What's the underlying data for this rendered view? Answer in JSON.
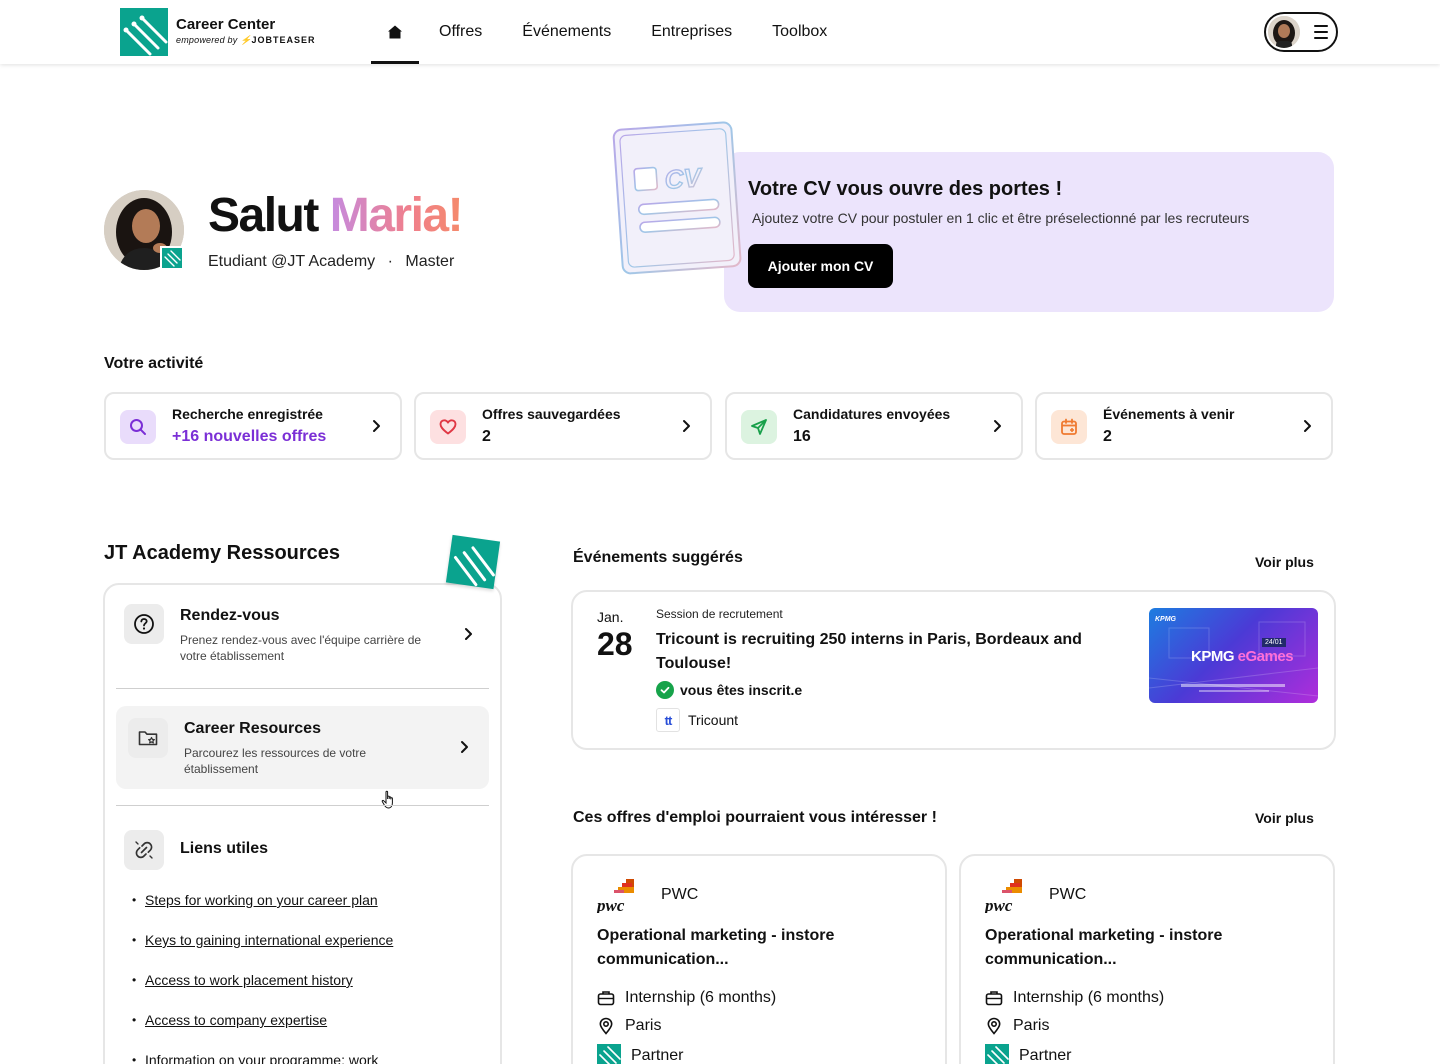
{
  "header": {
    "logo_title": "Career Center",
    "logo_sub": "empowered by",
    "logo_brand": "JOBTEASER",
    "nav": [
      "Offres",
      "Événements",
      "Entreprises",
      "Toolbox"
    ],
    "icons": {
      "home": "home-icon",
      "menu": "hamburger-menu-icon"
    }
  },
  "hero": {
    "greeting": "Salut",
    "name": "Maria!",
    "role": "Etudiant @JT Academy",
    "separator": "·",
    "level": "Master"
  },
  "cv_banner": {
    "illustration_text": "CV",
    "title": "Votre CV vous ouvre des portes !",
    "text": "Ajoutez votre CV pour postuler en 1 clic et être préselectionné par les recruteurs",
    "button": "Ajouter mon CV"
  },
  "activity": {
    "label": "Votre activité",
    "cards": [
      {
        "title": "Recherche enregistrée",
        "value": "+16 nouvelles offres",
        "icon": "search-icon",
        "color": "#e9dcfb"
      },
      {
        "title": "Offres sauvegardées",
        "value": "2",
        "icon": "heart-icon",
        "color": "#fde0e1"
      },
      {
        "title": "Candidatures envoyées",
        "value": "16",
        "icon": "send-icon",
        "color": "#dcf3e0"
      },
      {
        "title": "Événements à venir",
        "value": "2",
        "icon": "calendar-icon",
        "color": "#fde6d6"
      }
    ]
  },
  "resources": {
    "title": "JT Academy Ressources",
    "items": [
      {
        "title": "Rendez-vous",
        "desc": "Prenez rendez-vous avec l'équipe carrière de votre établissement",
        "icon": "question-icon"
      },
      {
        "title": "Career Resources",
        "desc": "Parcourez les ressources de votre établissement",
        "icon": "folder-star-icon"
      }
    ],
    "links_title": "Liens utiles",
    "links": [
      "Steps for working on your career plan",
      "Keys to gaining international experience",
      "Access to work placement history",
      "Access to company expertise",
      "Information on your programme: work"
    ]
  },
  "events": {
    "label": "Événements suggérés",
    "more": "Voir plus",
    "item": {
      "month": "Jan.",
      "day": "28",
      "type": "Session de recrutement",
      "title": "Tricount is recruiting 250 interns in Paris, Bordeaux and Toulouse!",
      "status": "vous êtes inscrit.e",
      "company": "Tricount",
      "company_logo": "tt",
      "image_brand": "KPMG",
      "image_title_a": "KPMG",
      "image_title_b": "eGames",
      "image_badge": "24/01"
    }
  },
  "jobs": {
    "label": "Ces offres d'emploi pourraient vous intéresser !",
    "more": "Voir plus",
    "items": [
      {
        "company": "PWC",
        "title": "Operational marketing - instore communication...",
        "contract": "Internship (6 months)",
        "location": "Paris",
        "tag": "Partner"
      },
      {
        "company": "PWC",
        "title": "Operational marketing - instore communication...",
        "contract": "Internship (6 months)",
        "location": "Paris",
        "tag": "Partner"
      }
    ]
  }
}
